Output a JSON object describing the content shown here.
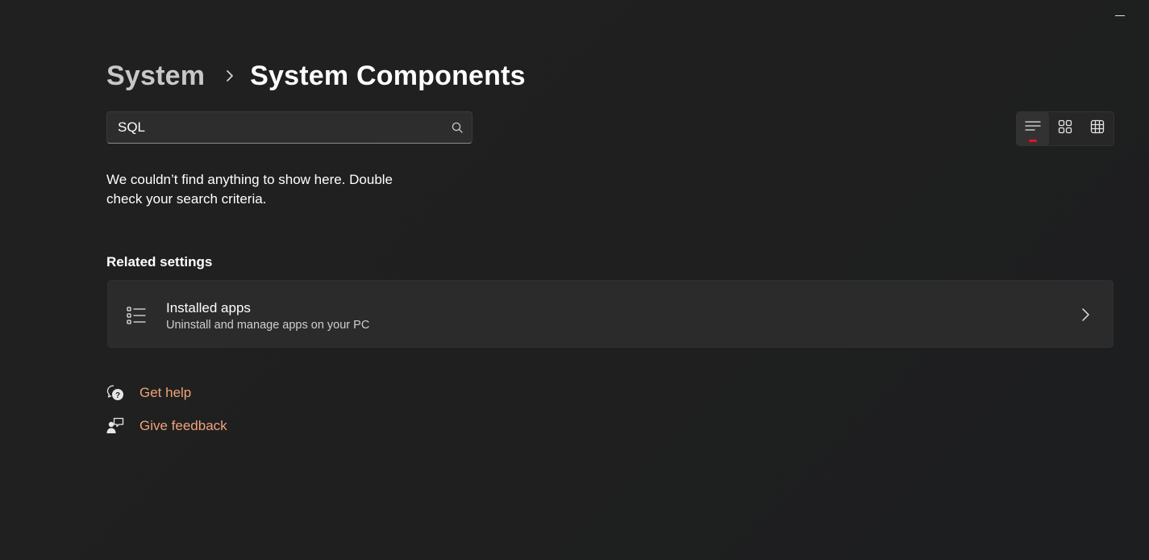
{
  "window": {
    "minimize_label": ""
  },
  "breadcrumb": {
    "parent": "System",
    "current": "System Components"
  },
  "search": {
    "value": "SQL",
    "placeholder": "Search"
  },
  "view_toggle": {
    "options": [
      "list-view",
      "grid-view",
      "table-view"
    ],
    "selected": "list-view"
  },
  "empty_state": {
    "message": "We couldn’t find anything to show here. Double check your search criteria."
  },
  "related": {
    "heading": "Related settings",
    "items": [
      {
        "title": "Installed apps",
        "subtitle": "Uninstall and manage apps on your PC",
        "icon": "list-icon"
      }
    ]
  },
  "help_links": [
    {
      "label": "Get help",
      "icon": "help-chat-icon"
    },
    {
      "label": "Give feedback",
      "icon": "feedback-icon"
    }
  ],
  "colors": {
    "background": "#202020",
    "card": "#2b2b2b",
    "link_accent": "#f0a27a",
    "selection_indicator": "#e81123"
  }
}
